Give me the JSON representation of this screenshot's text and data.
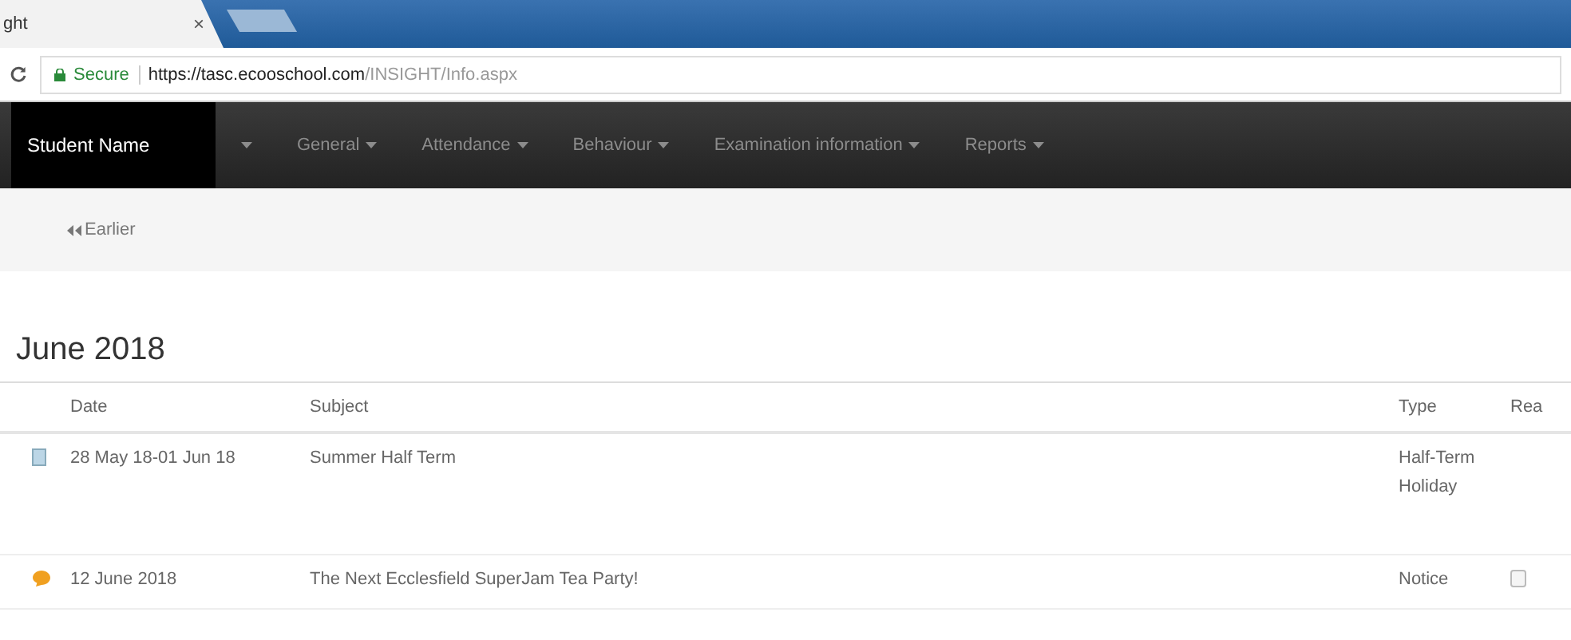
{
  "browser": {
    "tab_title": "ght",
    "tab_close": "×",
    "security": "Secure",
    "url_host": "https://tasc.ecooschool.com",
    "url_path": "/INSIGHT/Info.aspx"
  },
  "nav": [
    {
      "label": "Student Name",
      "kind": "masked"
    },
    {
      "label": "General",
      "kind": "menu"
    },
    {
      "label": "Attendance",
      "kind": "menu"
    },
    {
      "label": "Behaviour",
      "kind": "menu"
    },
    {
      "label": "Examination information",
      "kind": "menu"
    },
    {
      "label": "Reports",
      "kind": "menu"
    }
  ],
  "pager": {
    "earlier": "Earlier"
  },
  "heading": "June 2018",
  "table": {
    "columns": [
      "Date",
      "Subject",
      "Type",
      "Rea"
    ],
    "rows": [
      {
        "kind": "holiday",
        "date": "28 May 18-01 Jun 18",
        "subject": "Summer Half Term",
        "type": "Half-Term Holiday"
      },
      {
        "kind": "notice",
        "date": "12 June 2018",
        "subject": "The Next Ecclesfield SuperJam Tea Party!",
        "type": "Notice",
        "read": {
          "checked": false
        }
      }
    ]
  }
}
